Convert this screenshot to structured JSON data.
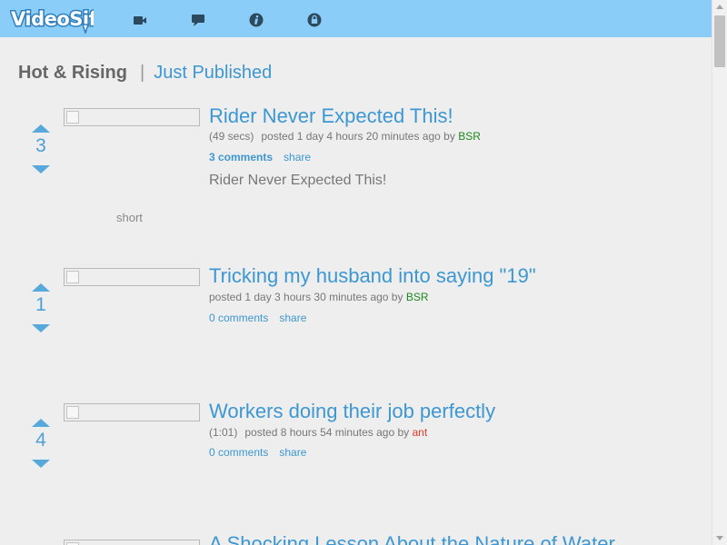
{
  "header": {
    "logo_text": "VideoSift",
    "nav": [
      {
        "name": "video-camera-icon"
      },
      {
        "name": "chat-bubble-icon"
      },
      {
        "name": "info-icon"
      },
      {
        "name": "lock-icon"
      }
    ],
    "colors": {
      "bar": "#89cdf8",
      "logo_fill": "#ffffff",
      "logo_outline": "#2e7fbe",
      "icon": "#2c4a5e"
    }
  },
  "tabs": {
    "active": "Hot & Rising",
    "separator": "|",
    "other": "Just Published"
  },
  "posts": [
    {
      "votes": "3",
      "title": "Rider Never Expected This!",
      "duration": "(49 secs)",
      "posted": "posted 1 day 4 hours 20 minutes ago by",
      "user": "BSR",
      "comments": "3 comments",
      "share": "share",
      "description": "Rider Never Expected This!",
      "tag": "short"
    },
    {
      "votes": "1",
      "title": "Tricking my husband into saying \"19\"",
      "posted": "posted 1 day 3 hours 30 minutes ago by",
      "user": "BSR",
      "comments": "0 comments",
      "share": "share"
    },
    {
      "votes": "4",
      "title": "Workers doing their job perfectly",
      "duration": "(1:01)",
      "posted": "posted 8 hours 54 minutes ago by",
      "user": "ant",
      "comments": "0 comments",
      "share": "share"
    },
    {
      "title": "A Shocking Lesson About the Nature of Water"
    }
  ],
  "colors": {
    "link": "#3c97d2",
    "vote_arrow": "#57a9dc",
    "user_green": "#1d8a1d",
    "user_red": "#e03a2a",
    "page_bg": "#eeeeee"
  }
}
